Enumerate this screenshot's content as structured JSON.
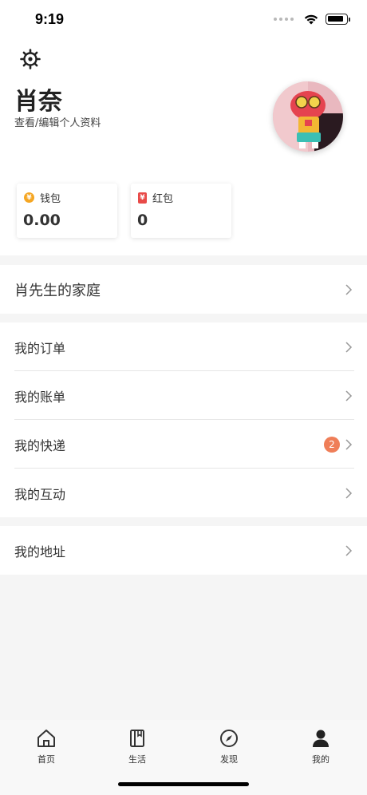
{
  "status_bar": {
    "time": "9:19",
    "icons": [
      "cellular-dots-icon",
      "wifi-icon",
      "battery-icon"
    ]
  },
  "profile": {
    "name": "肖奈",
    "subtitle": "查看/编辑个人资料",
    "settings_icon": "gear-icon"
  },
  "cards": {
    "wallet": {
      "label": "钱包",
      "value": "0.00",
      "icon": "coin-icon",
      "icon_text": "¥",
      "icon_color": "#f5a623"
    },
    "hongbao": {
      "label": "红包",
      "value": "0",
      "icon": "red-envelope-icon",
      "icon_text": "¥",
      "icon_color": "#e84a48"
    }
  },
  "family": {
    "label": "肖先生的家庭"
  },
  "menu": {
    "orders": "我的订单",
    "bills": "我的账单",
    "express": "我的快递",
    "express_badge": "2",
    "interact": "我的互动",
    "address": "我的地址"
  },
  "colors": {
    "badge": "#ef7e58",
    "background": "#f5f5f5"
  },
  "tabbar": {
    "home": "首页",
    "life": "生活",
    "discover": "发现",
    "mine": "我的"
  }
}
